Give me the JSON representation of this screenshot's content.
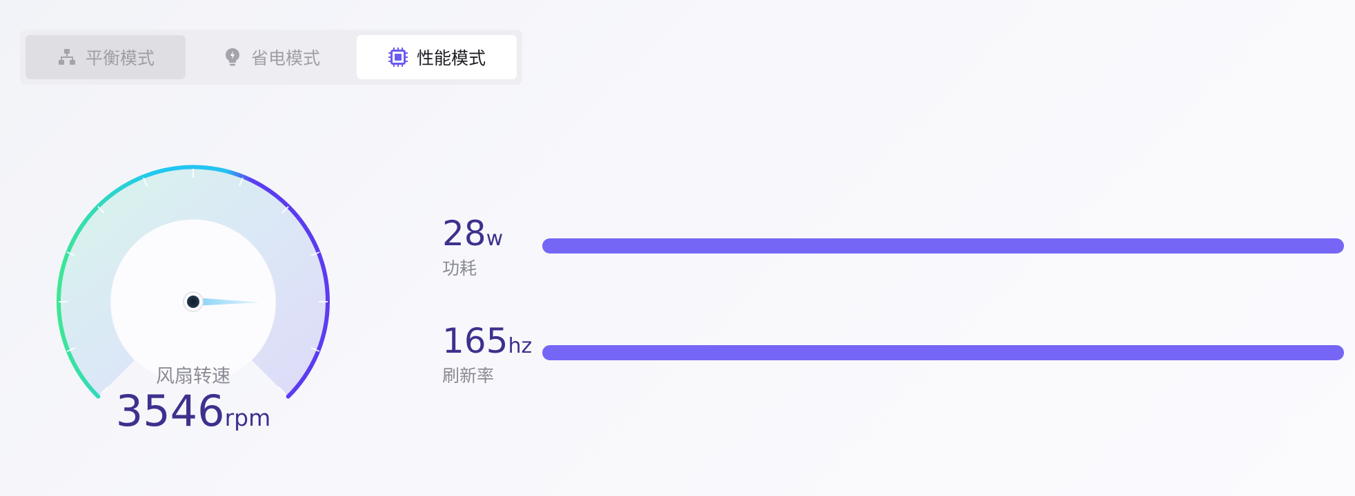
{
  "modes": {
    "balanced": {
      "label": "平衡模式",
      "icon": "network-icon"
    },
    "power_saving": {
      "label": "省电模式",
      "icon": "bulb-icon"
    },
    "performance": {
      "label": "性能模式",
      "icon": "chip-icon",
      "active": true
    }
  },
  "gauge": {
    "label": "风扇转速",
    "value": "3546",
    "unit": "rpm",
    "colors": {
      "start": "#3ee694",
      "mid": "#1fc8f0",
      "end": "#5b3cf0"
    }
  },
  "metrics": [
    {
      "value": "28",
      "unit": "w",
      "label": "功耗",
      "level": 1.0
    },
    {
      "value": "165",
      "unit": "hz",
      "label": "刷新率",
      "level": 1.0
    }
  ],
  "colors": {
    "accent": "#7566f5",
    "value_text": "#3d318d"
  }
}
